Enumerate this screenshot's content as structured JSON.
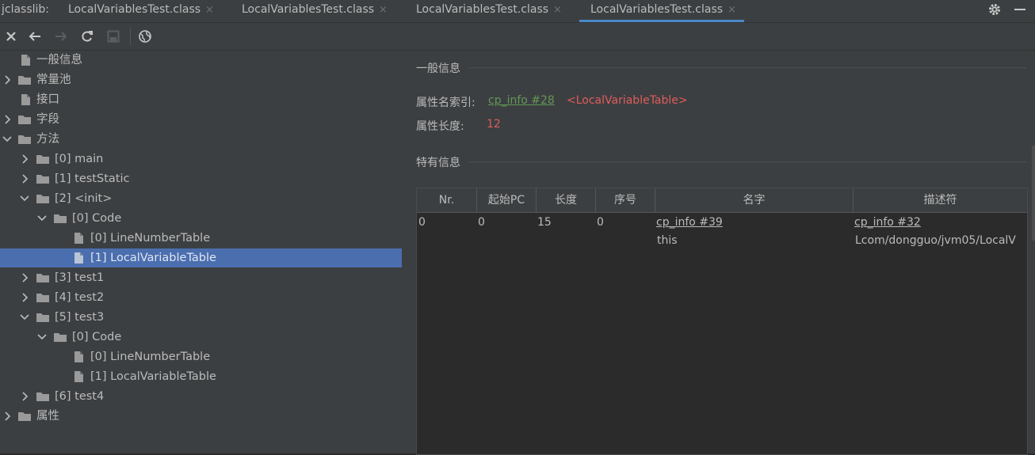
{
  "app": {
    "tool_label": "jclasslib:"
  },
  "tabs": [
    {
      "label": "LocalVariablesTest.class",
      "active": false
    },
    {
      "label": "LocalVariablesTest.class",
      "active": false
    },
    {
      "label": "LocalVariablesTest.class",
      "active": false
    },
    {
      "label": "LocalVariablesTest.class",
      "active": true
    }
  ],
  "tab_close_glyph": "×",
  "icons": {
    "settings": "gear-icon",
    "minimize": "minus-icon",
    "close": "close-icon",
    "back": "arrow-left-icon",
    "forward": "arrow-right-icon",
    "refresh": "refresh-icon",
    "save": "save-icon",
    "browser": "globe-icon"
  },
  "tree": [
    {
      "label": "一般信息",
      "type": "file"
    },
    {
      "label": "常量池",
      "type": "folder",
      "expanded": false
    },
    {
      "label": "接口",
      "type": "file"
    },
    {
      "label": "字段",
      "type": "folder",
      "expanded": false
    },
    {
      "label": "方法",
      "type": "folder",
      "expanded": true
    },
    {
      "label": "[0] main",
      "type": "folder",
      "expanded": false
    },
    {
      "label": "[1] testStatic",
      "type": "folder",
      "expanded": false
    },
    {
      "label": "[2] <init>",
      "type": "folder",
      "expanded": true
    },
    {
      "label": "[0] Code",
      "type": "folder",
      "expanded": true
    },
    {
      "label": "[0] LineNumberTable",
      "type": "file"
    },
    {
      "label": "[1] LocalVariableTable",
      "type": "file",
      "selected": true
    },
    {
      "label": "[3] test1",
      "type": "folder",
      "expanded": false
    },
    {
      "label": "[4] test2",
      "type": "folder",
      "expanded": false
    },
    {
      "label": "[5] test3",
      "type": "folder",
      "expanded": true
    },
    {
      "label": "[0] Code",
      "type": "folder",
      "expanded": true
    },
    {
      "label": "[0] LineNumberTable",
      "type": "file"
    },
    {
      "label": "[1] LocalVariableTable",
      "type": "file"
    },
    {
      "label": "[6] test4",
      "type": "folder",
      "expanded": false
    },
    {
      "label": "属性",
      "type": "folder",
      "expanded": false
    }
  ],
  "general": {
    "section_title": "一般信息",
    "attr_name_label": "属性名索引:",
    "attr_name_link": "cp_info #28",
    "attr_name_value": "<LocalVariableTable>",
    "attr_len_label": "属性长度:",
    "attr_len_value": "12"
  },
  "specific": {
    "section_title": "特有信息",
    "columns": [
      "Nr.",
      "起始PC",
      "长度",
      "序号",
      "名字",
      "描述符"
    ],
    "rows": [
      {
        "nr": "0",
        "start_pc": "0",
        "length": "15",
        "index": "0",
        "name_link": "cp_info #39",
        "name_value": "this",
        "desc_link": "cp_info #32",
        "desc_value": "Lcom/dongguo/jvm05/LocalV"
      }
    ]
  },
  "colors": {
    "accent": "#4a88c7",
    "selection": "#4b6eaf",
    "link": "#629755",
    "highlight": "#e05c5c"
  }
}
